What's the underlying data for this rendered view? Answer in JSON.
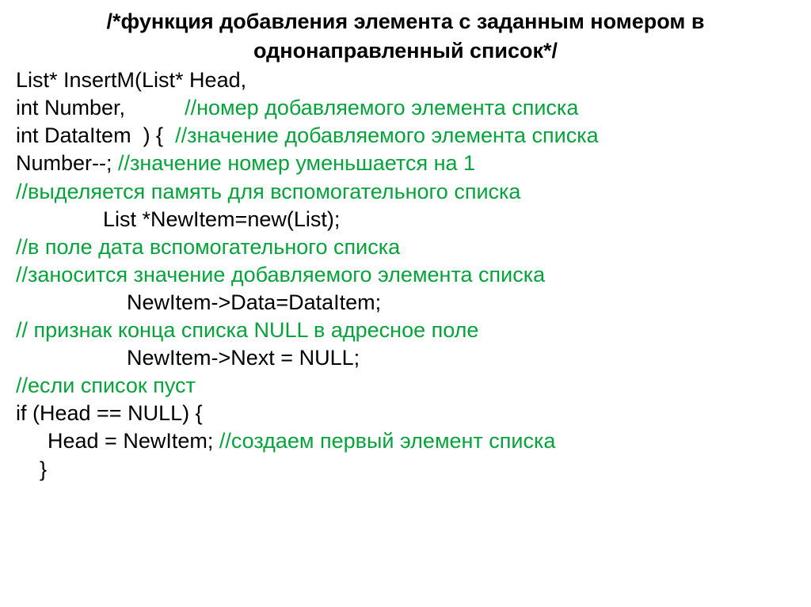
{
  "title": {
    "line1": "/*функция добавления элемента с заданным номером в",
    "line2": "однонаправленный список*/"
  },
  "lines": {
    "l1": "List* InsertM(List* Head,",
    "l2a": "int Number,          ",
    "l2b": "//номер добавляемого элемента списка",
    "l3a": "int DataItem  ) {  ",
    "l3b": "//значение добавляемого элемента списка",
    "l4a": "Number--; ",
    "l4b": "//значение номер уменьшается на 1",
    "l5": "//выделяется память для вспомогательного списка",
    "l6": "List *NewItem=new(List);",
    "l7": "//в поле дата вспомогательного списка",
    "l8": "//заносится значение добавляемого элемента списка",
    "l9": "NewItem->Data=DataItem;",
    "l10": "// признак конца списка NULL в адресное поле",
    "l11": "NewItem->Next = NULL;",
    "l12": "//если список пуст",
    "l13": "if (Head == NULL) {",
    "l14a": "Head = NewItem; ",
    "l14b": "//создаем первый элемент списка",
    "l15": "}"
  }
}
